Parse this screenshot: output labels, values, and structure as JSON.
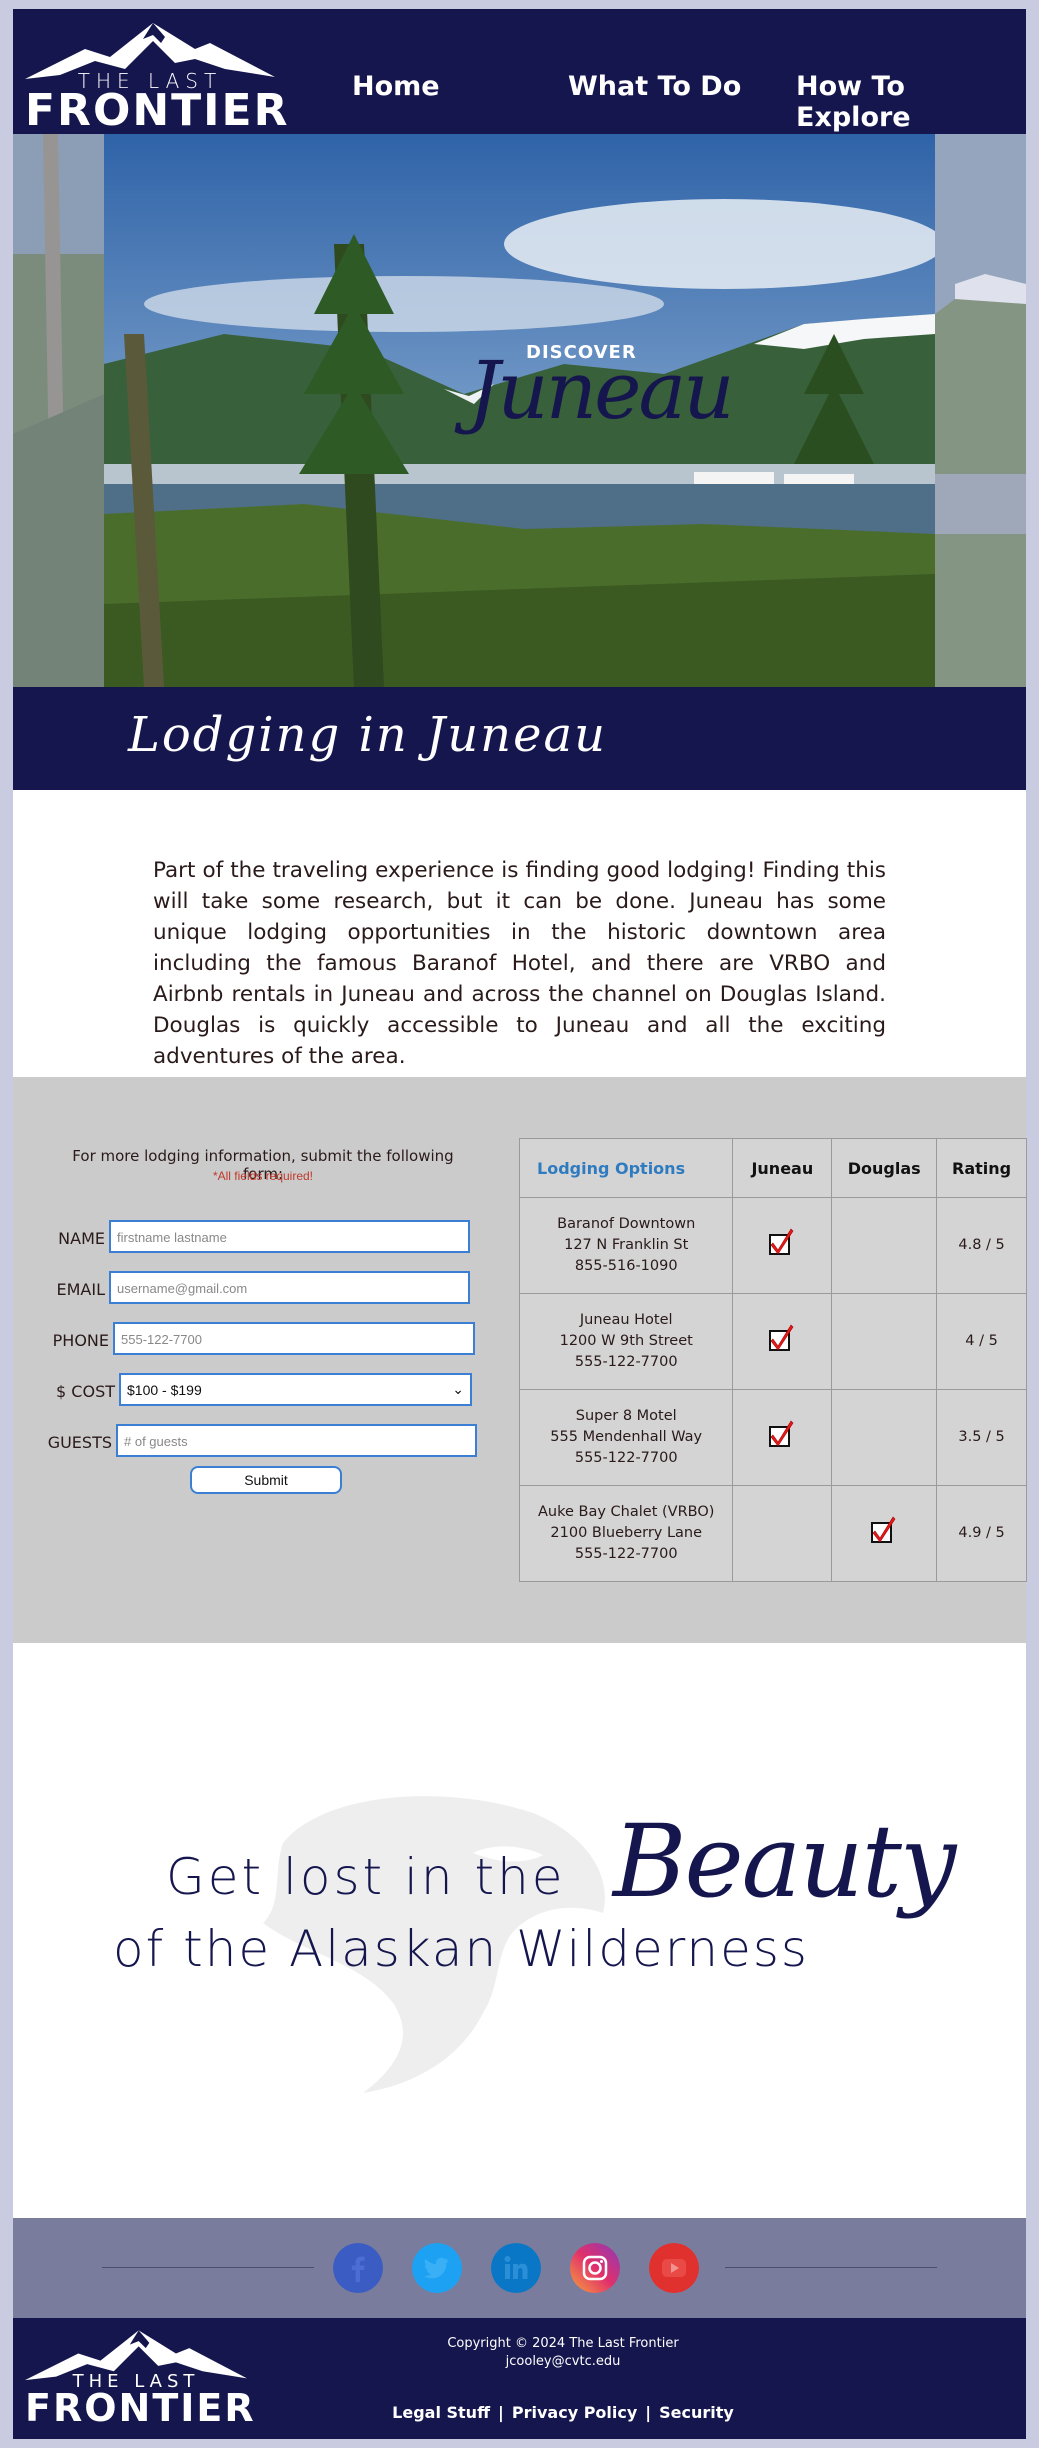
{
  "brand": {
    "the_last": "THE LAST",
    "frontier": "FRONTIER"
  },
  "nav": {
    "home": "Home",
    "what_to_do": "What To Do",
    "how_to_explore": "How To Explore"
  },
  "hero": {
    "discover": "DISCOVER",
    "city": "Juneau"
  },
  "lodging": {
    "title": "Lodging in Juneau"
  },
  "intro": "Part of the traveling experience is finding good lodging! Finding this will take some research, but it can be done. Juneau has some unique lodging opportunities in the historic downtown area including the famous Baranof Hotel, and there are VRBO and Airbnb rentals in Juneau and across the channel on Douglas Island. Douglas is quickly accessible to Juneau and all the exciting adventures of the area.",
  "form": {
    "title": "For more lodging information, submit the following form:",
    "required": "*All fields required!",
    "name_label": "NAME",
    "name_placeholder": "firstname lastname",
    "email_label": "EMAIL",
    "email_placeholder": "username@gmail.com",
    "phone_label": "PHONE",
    "phone_placeholder": "555-122-7700",
    "cost_label": "$ COST",
    "cost_value": "$100 - $199",
    "guests_label": "GUESTS",
    "guests_placeholder": "# of guests",
    "submit": "Submit"
  },
  "table": {
    "headers": [
      "Lodging Options",
      "Juneau",
      "Douglas",
      "Rating"
    ],
    "rows": [
      {
        "name": "Baranof Downtown",
        "address": "127 N Franklin St",
        "phone": "855-516-1090",
        "juneau": true,
        "douglas": false,
        "rating": "4.8 / 5"
      },
      {
        "name": "Juneau Hotel",
        "address": "1200 W 9th Street",
        "phone": "555-122-7700",
        "juneau": true,
        "douglas": false,
        "rating": "4 / 5"
      },
      {
        "name": "Super 8 Motel",
        "address": "555 Mendenhall Way",
        "phone": "555-122-7700",
        "juneau": true,
        "douglas": false,
        "rating": "3.5 / 5"
      },
      {
        "name": "Auke Bay Chalet (VRBO)",
        "address": "2100 Blueberry Lane",
        "phone": "555-122-7700",
        "juneau": false,
        "douglas": true,
        "rating": "4.9 / 5"
      }
    ]
  },
  "beauty": {
    "line1": "Get lost in the",
    "script": "Beauty",
    "line2": "of the Alaskan Wilderness"
  },
  "social": [
    "facebook-icon",
    "twitter-icon",
    "linkedin-icon",
    "instagram-icon",
    "youtube-icon"
  ],
  "footer": {
    "copyright": "Copyright © 2024 The Last Frontier",
    "email": "jcooley@cvtc.edu",
    "legal": "Legal Stuff",
    "privacy": "Privacy Policy",
    "security": "Security",
    "separator": "|"
  }
}
